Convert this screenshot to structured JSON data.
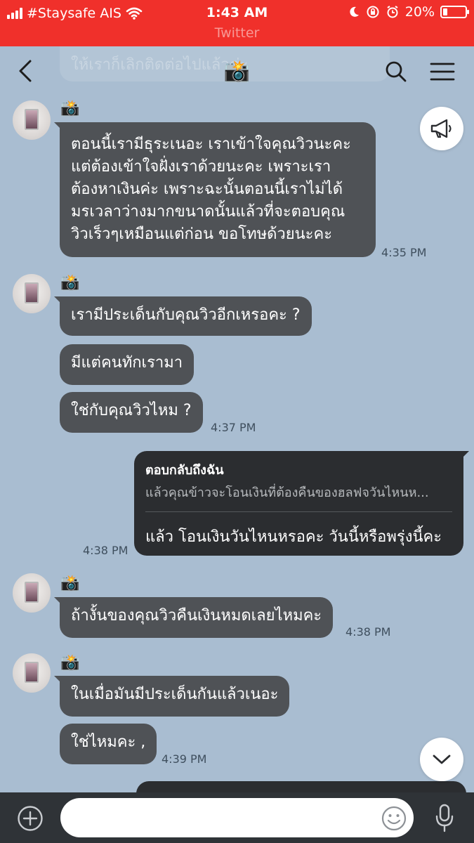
{
  "status_bar": {
    "carrier": "#Staysafe AIS",
    "time": "1:43 AM",
    "battery_text": "20%",
    "battery_level": 0.2,
    "back_label": "Twitter"
  },
  "header": {
    "title_emoji": "📸",
    "ghost_text": "ให้เราก็เลิกติดต่อไปแล้วค่ะ"
  },
  "messages": [
    {
      "sender": "📸",
      "bubbles": [
        "ตอนนี้เรามีธุระเนอะ เราเข้าใจคุณวิวนะคะ\nแต่ต้องเข้าใจฝั่งเราด้วยนะคะ เพราะเรา\nต้องหาเงินค่ะ เพราะฉะนั้นตอนนี้เราไม่ได้\nมรเวลาว่างมากขนาดนั้นแล้วที่จะตอบคุณ\nวิวเร็วๆเหมือนแต่ก่อน ขอโทษด้วยนะคะ"
      ],
      "time": "4:35 PM"
    },
    {
      "sender": "📸",
      "bubbles": [
        "เรามีประเด็นกับคุณวิวอีกเหรอคะ ?",
        "มีแต่คนทักเรามา",
        "ใช่กับคุณวิวไหม ?"
      ],
      "time": "4:37 PM"
    },
    {
      "outgoing": true,
      "reply_header": "ตอบกลับถึงฉัน",
      "reply_quote": "แล้วคุณข้าวจะโอนเงินที่ต้องคืนของฮลฟจวันไหนห...",
      "text": "แล้ว โอนเงินวันไหนหรอคะ วันนี้หรือพรุ่งนี้คะ",
      "time": "4:38 PM"
    },
    {
      "sender": "📸",
      "bubbles": [
        "ถ้างั้นของคุณวิวคืนเงินหมดเลยไหมคะ"
      ],
      "time": "4:38 PM"
    },
    {
      "sender": "📸",
      "bubbles": [
        "ในเมื่อมันมีประเด็นกันแล้วเนอะ",
        "ใช่ไหมคะ ,"
      ],
      "time": "4:39 PM"
    }
  ],
  "input": {
    "value": "",
    "placeholder": ""
  },
  "icons": {
    "back": "chevron-left-icon",
    "search": "search-icon",
    "menu": "hamburger-menu-icon",
    "announcement": "megaphone-icon",
    "scroll_down": "chevron-down-icon",
    "add": "plus-icon",
    "emoji": "smiley-icon",
    "voice": "microphone-icon"
  },
  "colors": {
    "status_bar": "#f0302b",
    "chat_background": "#a9bdd1",
    "incoming_bubble": "#4f5256",
    "outgoing_bubble": "#2b2d30",
    "input_bar": "#2f3337"
  }
}
